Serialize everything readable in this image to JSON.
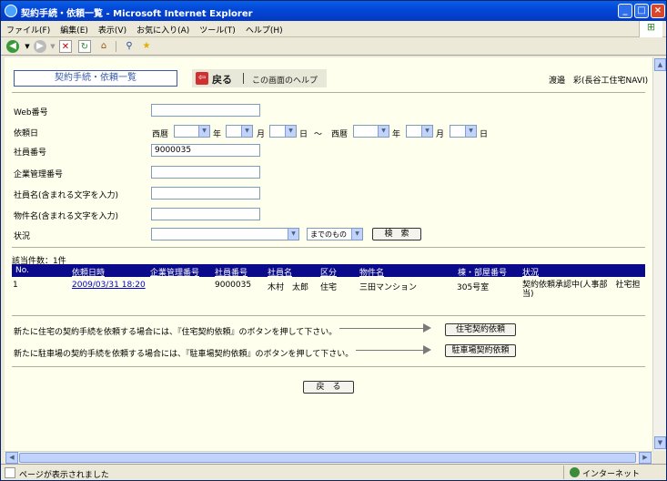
{
  "window": {
    "title": "契約手続・依頼一覧 - Microsoft Internet Explorer",
    "controls": [
      "_",
      "□",
      "×"
    ]
  },
  "menu": [
    "ファイル(F)",
    "編集(E)",
    "表示(V)",
    "お気に入り(A)",
    "ツール(T)",
    "ヘルプ(H)"
  ],
  "toolbar_icons": [
    "back-icon",
    "forward-icon",
    "stop-icon",
    "refresh-icon",
    "home-icon",
    "search-icon",
    "favorites-icon"
  ],
  "header": {
    "page_title": "契約手続・依頼一覧",
    "back_label": "戻る",
    "help_label": "この画面のヘルプ",
    "user": "渡邉　彩(長谷工住宅NAVI)"
  },
  "form": {
    "web_no_label": "Web番号",
    "web_no_value": "",
    "request_date_label": "依頼日",
    "era": "西暦",
    "year": "年",
    "month": "月",
    "day": "日",
    "tilde": "～",
    "employee_no_label": "社員番号",
    "employee_no_value": "9000035",
    "company_no_label": "企業管理番号",
    "company_no_value": "",
    "employee_name_label": "社員名(含まれる文字を入力)",
    "employee_name_value": "",
    "property_name_label": "物件名(含まれる文字を入力)",
    "property_name_value": "",
    "status_label": "状況",
    "status_value": "",
    "status_range": "までのもの",
    "search_button": "検　索"
  },
  "results": {
    "count_text": "該当件数：1件",
    "columns": [
      "No.",
      "依頼日時",
      "企業管理番号",
      "社員番号",
      "社員名",
      "区分",
      "物件名",
      "棟・部屋番号",
      "状況"
    ],
    "rows": [
      {
        "no": "1",
        "datetime": "2009/03/31 18:20",
        "company_no": "",
        "employee_no": "9000035",
        "name": "木村　太郎",
        "category": "住宅",
        "property": "三田マンション",
        "room": "305号室",
        "status": "契約依頼承認中(人事部　社宅担当)"
      }
    ]
  },
  "actions": {
    "housing_text": "新たに住宅の契約手続を依頼する場合には、『住宅契約依頼』のボタンを押して下さい。",
    "housing_button": "住宅契約依頼",
    "parking_text": "新たに駐車場の契約手続を依頼する場合には、『駐車場契約依頼』のボタンを押して下さい。",
    "parking_button": "駐車場契約依頼",
    "back_button": "戻　る"
  },
  "status_bar": {
    "text": "ページが表示されました",
    "zone": "インターネット"
  }
}
